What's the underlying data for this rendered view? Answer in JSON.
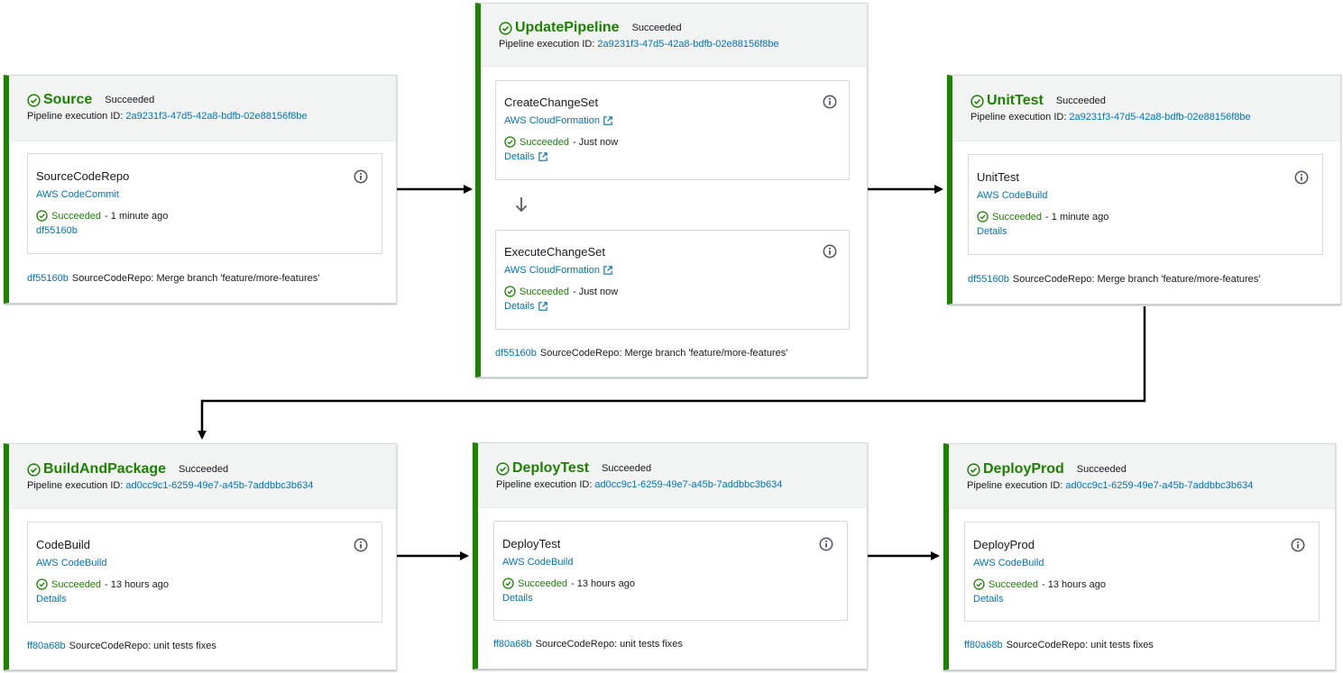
{
  "stages": {
    "source": {
      "title": "Source",
      "status": "Succeeded",
      "exec_label": "Pipeline execution ID:",
      "exec_id": "2a9231f3-47d5-42a8-bdfb-02e88156f8be",
      "action": {
        "name": "SourceCodeRepo",
        "provider": "AWS CodeCommit",
        "status": "Succeeded",
        "time": "- 1 minute ago",
        "link": "df55160b"
      },
      "footer": {
        "commit": "df55160b",
        "message": "SourceCodeRepo: Merge branch 'feature/more-features'"
      }
    },
    "update": {
      "title": "UpdatePipeline",
      "status": "Succeeded",
      "exec_label": "Pipeline execution ID:",
      "exec_id": "2a9231f3-47d5-42a8-bdfb-02e88156f8be",
      "actions": [
        {
          "name": "CreateChangeSet",
          "provider": "AWS CloudFormation",
          "status": "Succeeded",
          "time": "- Just now",
          "link": "Details"
        },
        {
          "name": "ExecuteChangeSet",
          "provider": "AWS CloudFormation",
          "status": "Succeeded",
          "time": "- Just now",
          "link": "Details"
        }
      ],
      "footer": {
        "commit": "df55160b",
        "message": "SourceCodeRepo: Merge branch 'feature/more-features'"
      }
    },
    "unittest": {
      "title": "UnitTest",
      "status": "Succeeded",
      "exec_label": "Pipeline execution ID:",
      "exec_id": "2a9231f3-47d5-42a8-bdfb-02e88156f8be",
      "action": {
        "name": "UnitTest",
        "provider": "AWS CodeBuild",
        "status": "Succeeded",
        "time": "- 1 minute ago",
        "link": "Details"
      },
      "footer": {
        "commit": "df55160b",
        "message": "SourceCodeRepo: Merge branch 'feature/more-features'"
      }
    },
    "build": {
      "title": "BuildAndPackage",
      "status": "Succeeded",
      "exec_label": "Pipeline execution ID:",
      "exec_id": "ad0cc9c1-6259-49e7-a45b-7addbbc3b634",
      "action": {
        "name": "CodeBuild",
        "provider": "AWS CodeBuild",
        "status": "Succeeded",
        "time": "- 13 hours ago",
        "link": "Details"
      },
      "footer": {
        "commit": "ff80a68b",
        "message": "SourceCodeRepo: unit tests fixes"
      }
    },
    "deploytest": {
      "title": "DeployTest",
      "status": "Succeeded",
      "exec_label": "Pipeline execution ID:",
      "exec_id": "ad0cc9c1-6259-49e7-a45b-7addbbc3b634",
      "action": {
        "name": "DeployTest",
        "provider": "AWS CodeBuild",
        "status": "Succeeded",
        "time": "- 13 hours ago",
        "link": "Details"
      },
      "footer": {
        "commit": "ff80a68b",
        "message": "SourceCodeRepo: unit tests fixes"
      }
    },
    "deployprod": {
      "title": "DeployProd",
      "status": "Succeeded",
      "exec_label": "Pipeline execution ID:",
      "exec_id": "ad0cc9c1-6259-49e7-a45b-7addbbc3b634",
      "action": {
        "name": "DeployProd",
        "provider": "AWS CodeBuild",
        "status": "Succeeded",
        "time": "- 13 hours ago",
        "link": "Details"
      },
      "footer": {
        "commit": "ff80a68b",
        "message": "SourceCodeRepo: unit tests fixes"
      }
    }
  },
  "colors": {
    "success": "#1d8102",
    "link": "#0073bb",
    "text": "#16191f",
    "header_bg": "#f2f3f3",
    "border": "#d5dbdb"
  },
  "icons": {
    "status": "check-circle-icon",
    "info": "info-icon",
    "external": "external-link-icon",
    "flow": "arrow-icon"
  }
}
